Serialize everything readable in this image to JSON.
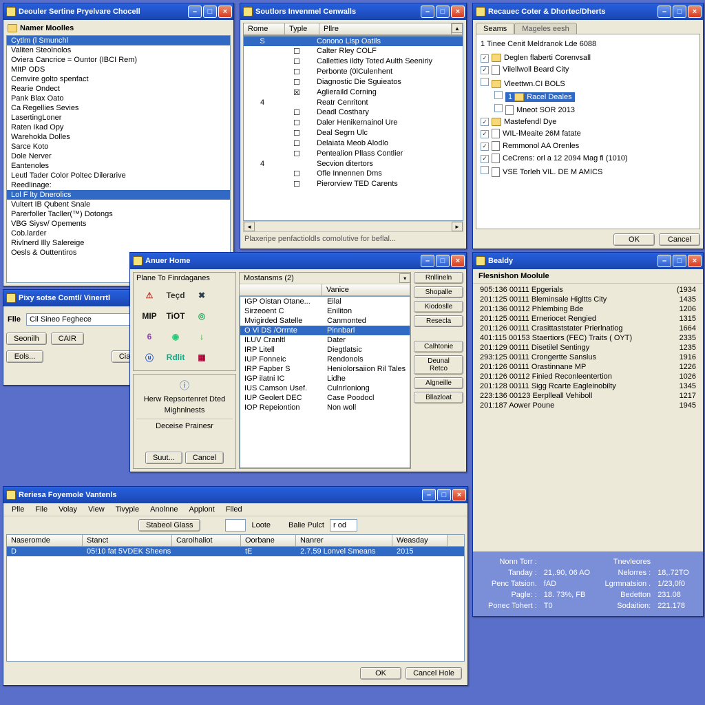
{
  "w1": {
    "title": "Deouler Sertine Pryelvare Chocell",
    "sub": "Namer Moolles",
    "items": [
      "Cytlm  (l Smunchl",
      "Valiten Steolnolos",
      "Oviera Cancrice = Ountor (IBCI Rem)",
      "MItP ODS",
      "Cemvire golto spenfact",
      "Rearie Ondect",
      "Pank Blax Oato",
      "Ca Regellies Sevies",
      "LasertingLoner",
      "Raten Ikad Opy",
      "Warehokla Dolles",
      "Sarce Koto",
      "Dole Nerver",
      "Eantenoles",
      "Leutl Tader Color Poltec Dilerarive",
      "Reedlinage:",
      "Lol F lty Dnerolics",
      "Vultert IB Qubent Snale",
      "Parerfoller Tacller(™) Dotongs",
      "VBG Siysv/ Opements",
      "Cob.larder",
      "Rivlnerd Illy Salereige",
      "Oesls & Outtentiros"
    ],
    "sel": 16
  },
  "w2": {
    "title": "Soutlors Invenmel Cenwalls",
    "cols": [
      "Rome",
      "Typle",
      "Pllre"
    ],
    "rows": [
      {
        "c": "S",
        "m": "",
        "t": "Conono Lisp Oatils",
        "sel": true
      },
      {
        "c": "",
        "m": "☐",
        "t": "Calter Rley COLF"
      },
      {
        "c": "",
        "m": "☐",
        "t": "Calletties ildty Toted Aulth Seeniriy"
      },
      {
        "c": "",
        "m": "☐",
        "t": "Perbonte (0lCulenhent"
      },
      {
        "c": "",
        "m": "☐",
        "t": "Diagnostic Die Sguieatos"
      },
      {
        "c": "",
        "m": "☒",
        "t": "Aglieraild Corning"
      },
      {
        "c": "4",
        "m": "",
        "t": "Reatr Cenritont"
      },
      {
        "c": "",
        "m": "☐",
        "t": "Deadl Costhary"
      },
      {
        "c": "",
        "m": "☐",
        "t": "Daler Henikernainol Ure"
      },
      {
        "c": "",
        "m": "☐",
        "t": "Deal Segrn Ulc"
      },
      {
        "c": "",
        "m": "☐",
        "t": "Delaiata Meob Alodlo"
      },
      {
        "c": "",
        "m": "☐",
        "t": "Pentealion Pllass Contlier"
      },
      {
        "c": "4",
        "m": "",
        "t": "Secvion ditertors"
      },
      {
        "c": "",
        "m": "☐",
        "t": "Ofle Innennen Dms"
      },
      {
        "c": "",
        "m": "☐",
        "t": "Pierorview TED Carents"
      }
    ],
    "footer": "Plaxeripe penfactioldls comolutive for beflal..."
  },
  "w3": {
    "title": "Recauec Coter & Dhortec/Dherts",
    "tabs": [
      "Seams",
      "Mageles eesh"
    ],
    "active": 0,
    "head": "1 Tinee Cenit Meldranok Lde 6088",
    "tree": [
      {
        "chk": true,
        "ic": "f",
        "t": "Deglen flaberti Corenvsall"
      },
      {
        "chk": true,
        "ic": "d",
        "t": "Vilellwoll Beard City"
      },
      {
        "chk": false,
        "ic": "f",
        "t": "Vleettwn.CI BOLS"
      },
      {
        "chk": false,
        "ic": "f",
        "t": "Racel Deales",
        "sel": true,
        "lvl": 1,
        "pre": "1"
      },
      {
        "chk": false,
        "ic": "d",
        "t": "Mneot SOR 2013",
        "lvl": 1
      },
      {
        "chk": true,
        "ic": "f",
        "t": "Mastefendl Dye"
      },
      {
        "chk": true,
        "ic": "d",
        "t": "WIL-lMeaite 26M fatate"
      },
      {
        "chk": true,
        "ic": "d",
        "t": "Remmonol AA Orenles"
      },
      {
        "chk": true,
        "ic": "d",
        "t": "CeCrens: orl a 12 2094 Mag fi (1010)"
      },
      {
        "chk": false,
        "ic": "d",
        "t": "VSE Torleh VIL. DE M AMICS"
      }
    ],
    "ok": "OK",
    "cancel": "Cancel"
  },
  "w4": {
    "title": "Pixy sotse Comtl/ Vinerrtl",
    "label_file": "Flle",
    "file_value": "Cil Sineo Feghece",
    "btns": [
      "Seonilh",
      "CAIR",
      "Eols...",
      "Ciancilo"
    ]
  },
  "w5": {
    "title": "Anuer Home",
    "panel_head": "Plane To Finrdaganes",
    "icons": [
      "⚠",
      "Teçd",
      "✖",
      "",
      "MIP",
      "TiOT",
      "◎",
      "",
      "6",
      "◉",
      "↓",
      "",
      "ⓤ",
      "Rdlit",
      "▦",
      ""
    ],
    "seg1": "Herw Repsortenret Dted",
    "seg2": "Mighnlnests",
    "seg3": "Deceise Prainesr",
    "btns": [
      "Suut...",
      "Cancel"
    ],
    "mid_head": "Mostansms  (2)",
    "mid_icon": "⬇",
    "cols": [
      "",
      "Vanice"
    ],
    "rows": [
      [
        "IGP Oistan Otane...",
        "Eilal"
      ],
      [
        "Sirzeoent C",
        "Eniliton"
      ],
      [
        "Mvigirded Satelle",
        "Canmonted"
      ],
      [
        "O Vi DS /Orrnte",
        "Pinnbarl"
      ],
      [
        "ILUV Cranltl",
        "Dater"
      ],
      [
        "IRP Litell",
        "Diegtlatsic"
      ],
      [
        "IUP Fonneic",
        "Rendonols"
      ],
      [
        "IRP Fapber S",
        "Heniolorsaiion Ril Tales"
      ],
      [
        "IGP ilatni IC",
        "Lidhe"
      ],
      [
        "IUS Camson Usef.",
        "Culnrloniong"
      ],
      [
        "IUP Geolert DEC",
        "Case Poodocl"
      ],
      [
        "IOP Repeiontion",
        "Non woll"
      ]
    ],
    "sel": 3,
    "side_btns": [
      "Rnllineln",
      "Shopalle",
      "Kiodoslle",
      "Resecla",
      "Calhtonie",
      "Deunal Retco",
      "Algneille",
      "Bllazloat"
    ]
  },
  "w6": {
    "title": "Bealdy",
    "sub": "Flesnishon Moolule",
    "rows": [
      [
        "905:136 00111 Epgerials",
        "(1934"
      ],
      [
        "201:125 00111 Bleminsale Higltts City",
        "1435"
      ],
      [
        "201:136 00112 Phlembing Bde",
        "1206"
      ],
      [
        "201:125 00111 Erneriocet Rengied",
        "1315"
      ],
      [
        "201:126 00111 Crasittaststater Prierlnatiog",
        "1664"
      ],
      [
        "401:115 00153 Staertiors (FEC) Traits ( OYT)",
        "2335"
      ],
      [
        "201:129 00111 Disetilel Sentingy",
        "1235"
      ],
      [
        "293:125 00111 Crongertte Sanslus",
        "1916"
      ],
      [
        "201:126 00111 Orastinnane MP",
        "1226"
      ],
      [
        "201:126 00112 Finied Reconleentertion",
        "1026"
      ],
      [
        "201:128 00111 Sigg Rcarte Eagleinobilty",
        "1345"
      ],
      [
        "223:136 00123 Eerplleall Vehiboll",
        "1217"
      ],
      [
        "201:187 Aower Poune",
        "1945"
      ]
    ],
    "footer": [
      [
        "Nonn Torr :",
        "",
        "Tnevleores",
        ""
      ],
      [
        "Tanday :",
        "21,.90, 06 AO",
        "Nelorres :",
        "18,.72TO"
      ],
      [
        "Penc Tatsion.",
        "fAD",
        "Lgrmnatsion .",
        "1/23,0f0"
      ],
      [
        "Pagle: :",
        "18. 73%, FB",
        "Bedetton",
        "231.08"
      ],
      [
        "Ponec Tohert :",
        "T0",
        "Sodaition:",
        "221.178"
      ]
    ]
  },
  "w7": {
    "title": "Reriesa Foyemole Vantenls",
    "menu": [
      "Plle",
      "Flle",
      "Volay",
      "View",
      "Tivyple",
      "Anolnne",
      "Applont",
      "Flled"
    ],
    "tb_btn": "Stabeol Glass",
    "tb_lbl1": "Loote",
    "tb_lbl2": "Balie Pulct",
    "tb_val": "r od",
    "cols": [
      "Naseromde",
      "Stanct",
      "Carolhaliot",
      "Oorbane",
      "Nanrer",
      "Weasday"
    ],
    "row": [
      "D",
      "05!10 fat  5VDEK Sheens",
      "",
      "tE",
      "2.7.59 Lonvel Smeans",
      "2015"
    ],
    "ok": "OK",
    "cancel": "Cancel Hole"
  }
}
